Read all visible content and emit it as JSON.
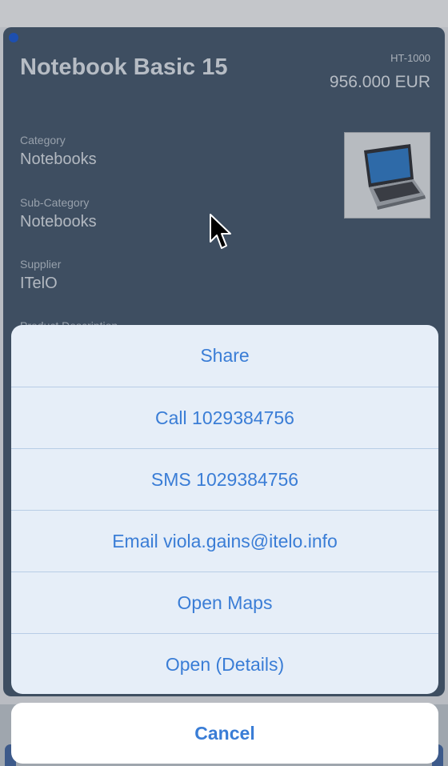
{
  "product": {
    "title": "Notebook Basic 15",
    "code": "HT-1000",
    "price": "956.000 EUR",
    "fields": [
      {
        "label": "Category",
        "value": "Notebooks"
      },
      {
        "label": "Sub-Category",
        "value": "Notebooks"
      },
      {
        "label": "Supplier",
        "value": "ITelO"
      }
    ],
    "description_label": "Product Description"
  },
  "action_sheet": {
    "actions": [
      {
        "label": "Share"
      },
      {
        "label": "Call 1029384756"
      },
      {
        "label": "SMS 1029384756"
      },
      {
        "label": "Email viola.gains@itelo.info"
      },
      {
        "label": "Open Maps"
      },
      {
        "label": "Open (Details)"
      }
    ],
    "cancel_label": "Cancel"
  },
  "colors": {
    "accent": "#3a7dd6",
    "dim_card": "#3e4e61",
    "sheet_bg": "#e6eef8"
  }
}
